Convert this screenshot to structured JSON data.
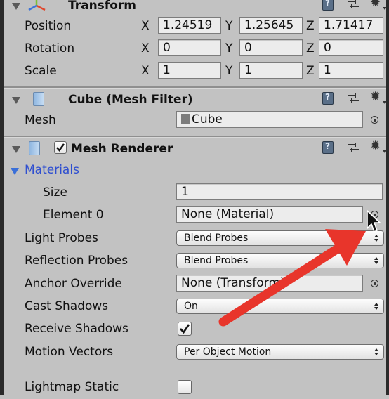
{
  "transform": {
    "title": "Transform",
    "position": {
      "label": "Position",
      "x": "1.24519",
      "y": "1.25645",
      "z": "1.71417"
    },
    "rotation": {
      "label": "Rotation",
      "x": "0",
      "y": "0",
      "z": "0"
    },
    "scale": {
      "label": "Scale",
      "x": "1",
      "y": "1",
      "z": "1"
    },
    "axis_x": "X",
    "axis_y": "Y",
    "axis_z": "Z"
  },
  "mesh_filter": {
    "title": "Cube (Mesh Filter)",
    "mesh_label": "Mesh",
    "mesh_value": "Cube"
  },
  "mesh_renderer": {
    "title": "Mesh Renderer",
    "enabled": true,
    "materials_label": "Materials",
    "size_label": "Size",
    "size_value": "1",
    "element0_label": "Element 0",
    "element0_value": "None (Material)",
    "light_probes_label": "Light Probes",
    "light_probes_value": "Blend Probes",
    "reflection_probes_label": "Reflection Probes",
    "reflection_probes_value": "Blend Probes",
    "anchor_override_label": "Anchor Override",
    "anchor_override_value": "None (Transform)",
    "cast_shadows_label": "Cast Shadows",
    "cast_shadows_value": "On",
    "receive_shadows_label": "Receive Shadows",
    "receive_shadows_checked": true,
    "motion_vectors_label": "Motion Vectors",
    "motion_vectors_value": "Per Object Motion",
    "lightmap_static_label": "Lightmap Static",
    "lightmap_static_checked": false
  },
  "colors": {
    "panel_bg": "#c2c2c2",
    "materials_label": "#2f4fd0",
    "annotation_arrow": "#e8352b",
    "checkmark": "#111111"
  }
}
